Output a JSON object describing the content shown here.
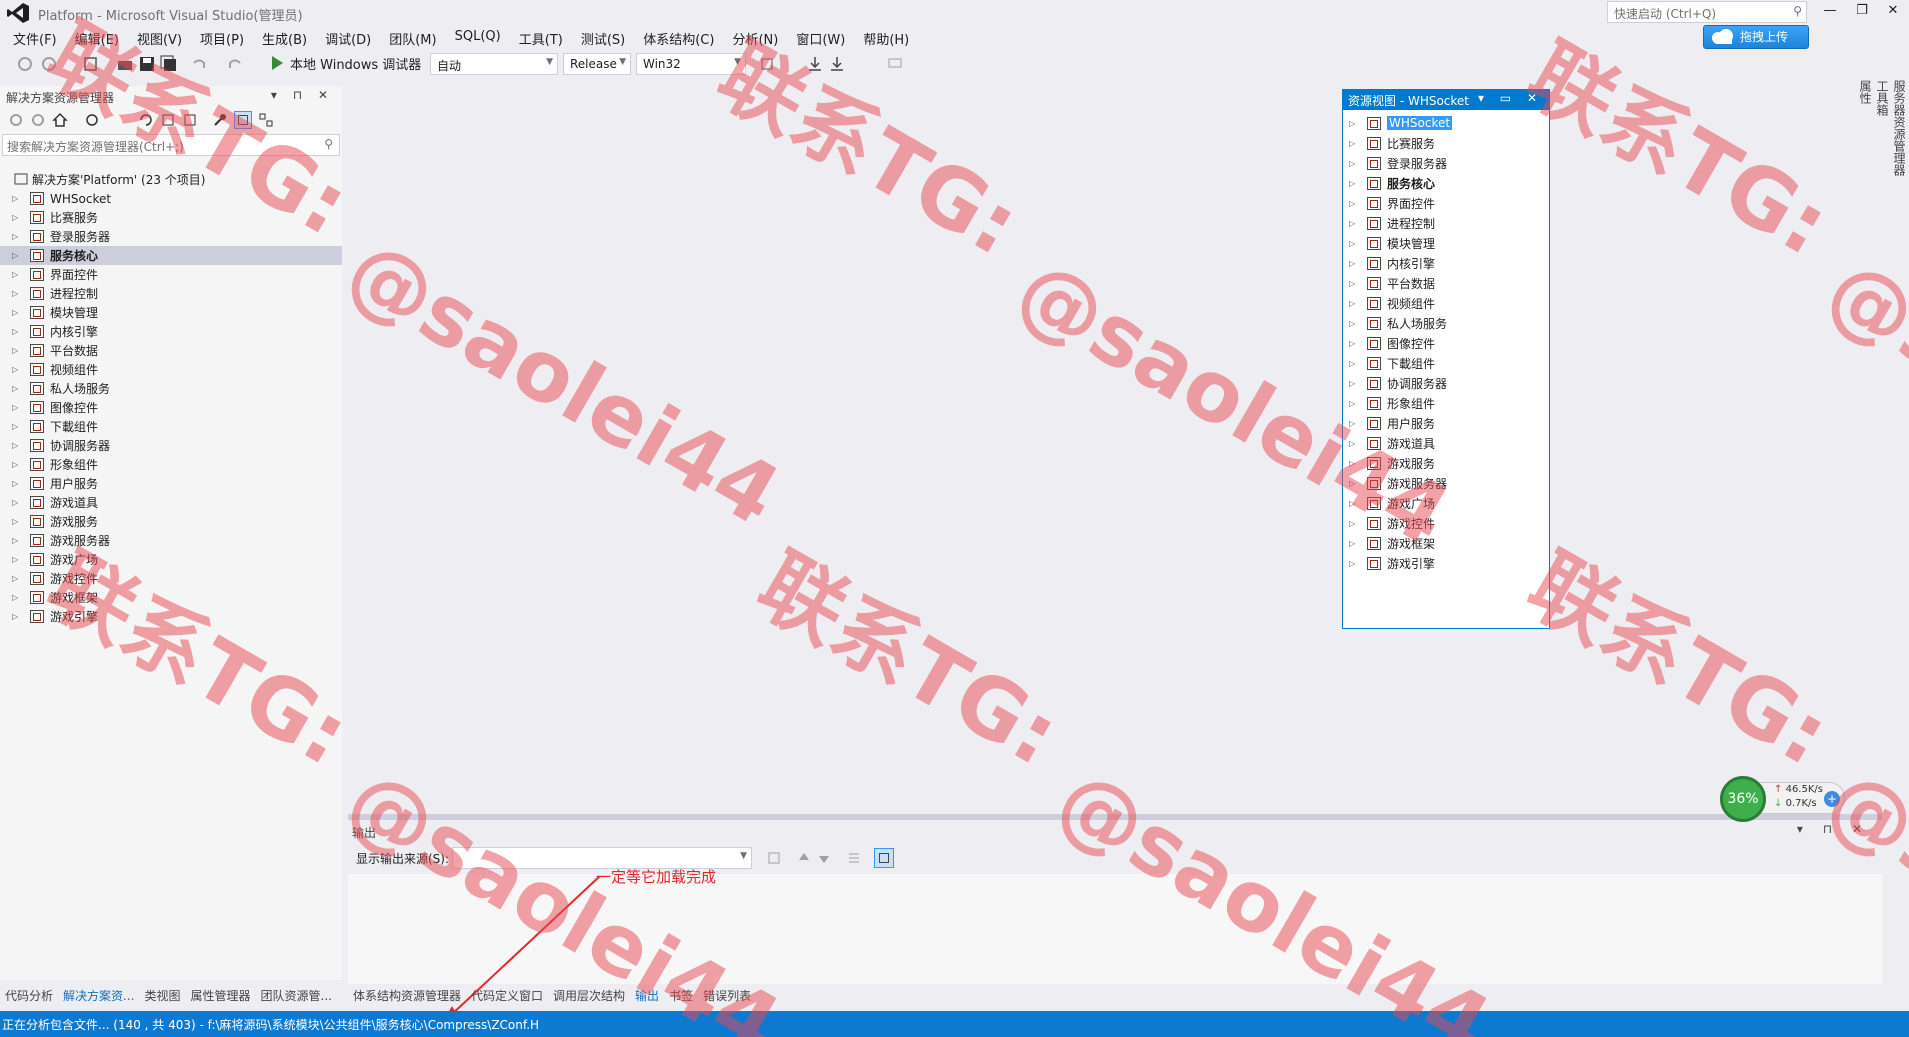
{
  "window": {
    "title": "Platform - Microsoft Visual Studio(管理员)",
    "quick_launch_placeholder": "快速启动 (Ctrl+Q)",
    "upload_button": "拖拽上传",
    "minimize": "—",
    "restore": "❐",
    "close": "✕"
  },
  "menu": [
    "文件(F)",
    "编辑(E)",
    "视图(V)",
    "项目(P)",
    "生成(B)",
    "调试(D)",
    "团队(M)",
    "SQL(Q)",
    "工具(T)",
    "测试(S)",
    "体系结构(C)",
    "分析(N)",
    "窗口(W)",
    "帮助(H)"
  ],
  "toolbar": {
    "debugger_label": "本地 Windows 调试器",
    "debugger_dropdown": "▾",
    "auto_combo": "自动",
    "config_combo": "Release",
    "platform_combo": "Win32"
  },
  "solution_explorer": {
    "title": "解决方案资源管理器",
    "header_buttons": "▾ ⊓ ✕",
    "search_placeholder": "搜索解决方案资源管理器(Ctrl+;)",
    "solution_label": "解决方案'Platform' (23 个项目)",
    "projects": [
      {
        "label": "WHSocket",
        "bold": false,
        "selected": false
      },
      {
        "label": "比赛服务",
        "bold": false,
        "selected": false
      },
      {
        "label": "登录服务器",
        "bold": false,
        "selected": false
      },
      {
        "label": "服务核心",
        "bold": true,
        "selected": true
      },
      {
        "label": "界面控件",
        "bold": false,
        "selected": false
      },
      {
        "label": "进程控制",
        "bold": false,
        "selected": false
      },
      {
        "label": "模块管理",
        "bold": false,
        "selected": false
      },
      {
        "label": "内核引擎",
        "bold": false,
        "selected": false
      },
      {
        "label": "平台数据",
        "bold": false,
        "selected": false
      },
      {
        "label": "视频组件",
        "bold": false,
        "selected": false
      },
      {
        "label": "私人场服务",
        "bold": false,
        "selected": false
      },
      {
        "label": "图像控件",
        "bold": false,
        "selected": false
      },
      {
        "label": "下載组件",
        "bold": false,
        "selected": false
      },
      {
        "label": "协调服务器",
        "bold": false,
        "selected": false
      },
      {
        "label": "形象组件",
        "bold": false,
        "selected": false
      },
      {
        "label": "用户服务",
        "bold": false,
        "selected": false
      },
      {
        "label": "游戏道具",
        "bold": false,
        "selected": false
      },
      {
        "label": "游戏服务",
        "bold": false,
        "selected": false
      },
      {
        "label": "游戏服务器",
        "bold": false,
        "selected": false
      },
      {
        "label": "游戏广场",
        "bold": false,
        "selected": false
      },
      {
        "label": "游戏控件",
        "bold": false,
        "selected": false
      },
      {
        "label": "游戏框架",
        "bold": false,
        "selected": false
      },
      {
        "label": "游戏引擎",
        "bold": false,
        "selected": false
      }
    ],
    "bottom_tabs": [
      {
        "label": "代码分析",
        "active": false
      },
      {
        "label": "解决方案资...",
        "active": true
      },
      {
        "label": "类视图",
        "active": false
      },
      {
        "label": "属性管理器",
        "active": false
      },
      {
        "label": "团队资源管...",
        "active": false
      }
    ]
  },
  "resource_view": {
    "title": "资源视图 - WHSocket",
    "title_buttons": "▾ ▭ ✕",
    "items": [
      {
        "label": "WHSocket",
        "bold": false,
        "highlight": true
      },
      {
        "label": "比赛服务",
        "bold": false,
        "highlight": false
      },
      {
        "label": "登录服务器",
        "bold": false,
        "highlight": false
      },
      {
        "label": "服务核心",
        "bold": true,
        "highlight": false
      },
      {
        "label": "界面控件",
        "bold": false,
        "highlight": false
      },
      {
        "label": "进程控制",
        "bold": false,
        "highlight": false
      },
      {
        "label": "模块管理",
        "bold": false,
        "highlight": false
      },
      {
        "label": "内核引擎",
        "bold": false,
        "highlight": false
      },
      {
        "label": "平台数据",
        "bold": false,
        "highlight": false
      },
      {
        "label": "视频组件",
        "bold": false,
        "highlight": false
      },
      {
        "label": "私人场服务",
        "bold": false,
        "highlight": false
      },
      {
        "label": "图像控件",
        "bold": false,
        "highlight": false
      },
      {
        "label": "下載组件",
        "bold": false,
        "highlight": false
      },
      {
        "label": "协调服务器",
        "bold": false,
        "highlight": false
      },
      {
        "label": "形象组件",
        "bold": false,
        "highlight": false
      },
      {
        "label": "用户服务",
        "bold": false,
        "highlight": false
      },
      {
        "label": "游戏道具",
        "bold": false,
        "highlight": false
      },
      {
        "label": "游戏服务",
        "bold": false,
        "highlight": false
      },
      {
        "label": "游戏服务器",
        "bold": false,
        "highlight": false
      },
      {
        "label": "游戏广场",
        "bold": false,
        "highlight": false
      },
      {
        "label": "游戏控件",
        "bold": false,
        "highlight": false
      },
      {
        "label": "游戏框架",
        "bold": false,
        "highlight": false
      },
      {
        "label": "游戏引擎",
        "bold": false,
        "highlight": false
      }
    ]
  },
  "output": {
    "title": "输出",
    "header_buttons": "▾ ⊓ ✕",
    "source_label": "显示输出来源(S):",
    "source_value": "",
    "annotation": "一定等它加载完成"
  },
  "bottom_tabs": [
    {
      "label": "体系结构资源管理器",
      "active": false
    },
    {
      "label": "代码定义窗口",
      "active": false
    },
    {
      "label": "调用层次结构",
      "active": false
    },
    {
      "label": "输出",
      "active": true
    },
    {
      "label": "书签",
      "active": false
    },
    {
      "label": "错误列表",
      "active": false
    }
  ],
  "right_tabs": [
    "服务器资源管理器",
    "工具箱",
    "属性"
  ],
  "network": {
    "percent": "36%",
    "upload": "46.5K/s",
    "download": "0.7K/s",
    "plus": "+"
  },
  "status_bar": "正在分析包含文件... (140 , 共 403) - f:\\麻将源码\\系统模块\\公共组件\\服务核心\\Compress\\ZConf.H",
  "watermark": {
    "line1": "联系TG:",
    "line2": "@saolei44"
  },
  "colors": {
    "accent": "#007ACC",
    "status_bar": "#0E79D0",
    "selection": "#CCCEDB",
    "watermark": "#E84852"
  }
}
